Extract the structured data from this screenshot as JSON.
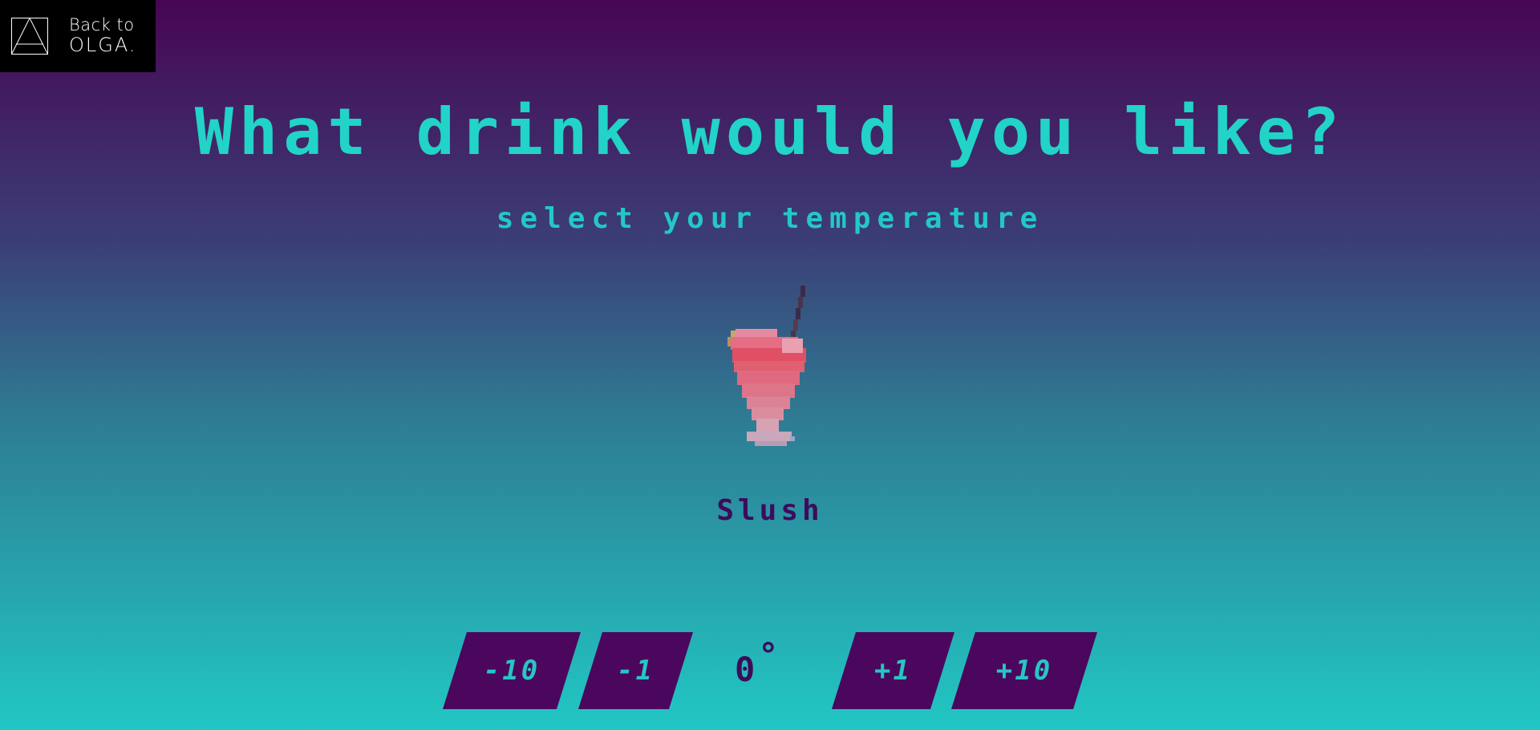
{
  "back_link": {
    "line1": "Back to",
    "line2": "OLGA."
  },
  "title": "What drink would you like?",
  "subtitle": "select your temperature",
  "drink": {
    "name": "Slush",
    "image_icon": "slush-drink-icon"
  },
  "temperature": {
    "value": "0",
    "unit": "°"
  },
  "buttons": {
    "minus_ten": "-10",
    "minus_one": "-1",
    "plus_one": "+1",
    "plus_ten": "+10"
  },
  "colors": {
    "gradient_top": "#470652",
    "gradient_bottom": "#21c7c4",
    "accent": "#22d3c8",
    "button_bg": "#4b075d",
    "drink_name": "#3e0b5b"
  }
}
